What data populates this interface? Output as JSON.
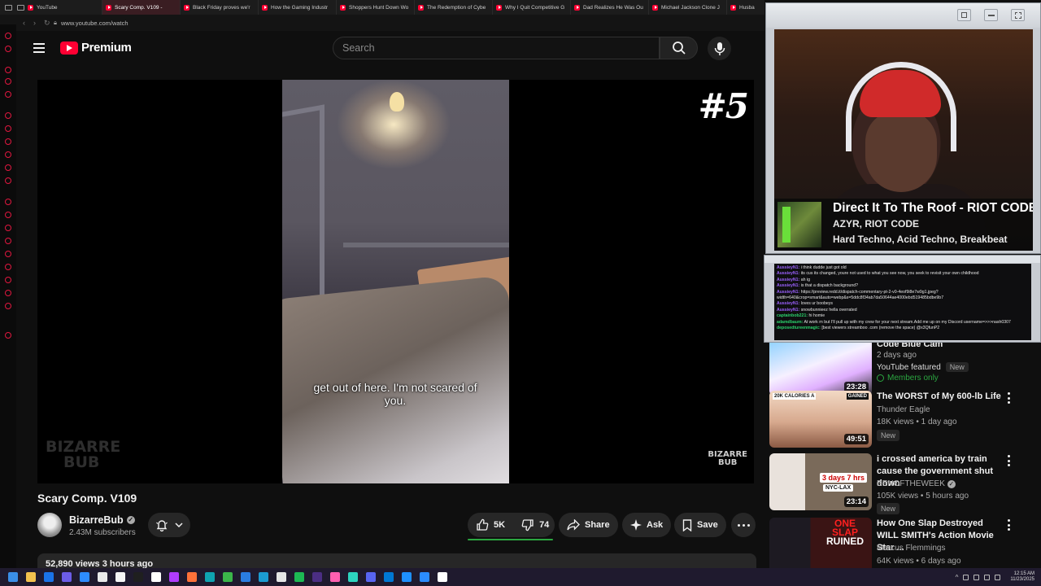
{
  "browser": {
    "tabs": [
      {
        "label": "YouTube",
        "active": false
      },
      {
        "label": "Scary Comp. V109 -",
        "active": true
      },
      {
        "label": "Black Friday proves we'r",
        "active": false
      },
      {
        "label": "How the Gaming Industr",
        "active": false
      },
      {
        "label": "Shoppers Hunt Down Wo",
        "active": false
      },
      {
        "label": "The Redemption of Cybe",
        "active": false
      },
      {
        "label": "Why I Quit Competitive G",
        "active": false
      },
      {
        "label": "Dad Realizes He Was Ou",
        "active": false
      },
      {
        "label": "Michael Jackson Clone J",
        "active": false
      },
      {
        "label": "Husba",
        "active": false
      }
    ],
    "url": "www.youtube.com/watch"
  },
  "header": {
    "logo_text": "Premium",
    "search_placeholder": "Search"
  },
  "video": {
    "subtitle": "get out of here. I'm not scared of you.",
    "episode_mark": "#5",
    "watermark_left_line1": "BIZARRE",
    "watermark_left_line2": "BUB",
    "watermark_right_line1": "BIZARRE",
    "watermark_right_line2": "BUB",
    "title": "Scary Comp. V109"
  },
  "channel": {
    "name": "BizarreBub",
    "subscribers": "2.43M subscribers"
  },
  "actions": {
    "likes": "5K",
    "dislikes": "74",
    "like_ratio": 0.985,
    "share": "Share",
    "ask": "Ask",
    "save": "Save"
  },
  "description": {
    "meta": "52,890 views  3 hours ago"
  },
  "recommendations": [
    {
      "title": "Code Blue Cam",
      "channel": "",
      "meta": "2 days ago",
      "featured": "YouTube featured",
      "badge": "New",
      "members": "Members only",
      "duration": "23:28"
    },
    {
      "title": "The WORST of My 600-lb Life",
      "channel": "Thunder Eagle",
      "meta": "18K views • 1 day ago",
      "badge": "New",
      "duration": "49:51",
      "thumb_text_left": "20K CALORIES A",
      "thumb_text_right": "GAINED"
    },
    {
      "title": "i crossed america by train cause the government shut down",
      "channel": "BENOFTHEWEEK",
      "meta": "105K views • 5 hours ago",
      "badge": "New",
      "duration": "23:14",
      "thumb_text_1": "3 days 7 hrs",
      "thumb_text_2": "NYC-LAX"
    },
    {
      "title": "How One Slap Destroyed WILL SMITH's Action Movie Star ...",
      "channel": "Marcus Flemmings",
      "meta": "64K views • 6 days ago",
      "thumb_text_1": "ONE",
      "thumb_text_2": "SLAP",
      "thumb_text_3": "RUINED"
    }
  ],
  "stream_overlay": {
    "now_playing_title": "Direct It To The Roof - RIOT CODE Remi",
    "now_playing_artist": "AZYR, RIOT CODE",
    "now_playing_genre": "Hard Techno, Acid Techno, Breakbeat"
  },
  "chat": [
    {
      "user": "AussieyN1:",
      "msg": "i think dudde just got old",
      "green": false
    },
    {
      "user": "AussieyN1:",
      "msg": "its cus its changed, youre not used to what you see now, you seek to revisit your own childhood",
      "green": false
    },
    {
      "user": "AussieyN1:",
      "msg": "ah ig",
      "green": false
    },
    {
      "user": "AussieyN1:",
      "msg": "is that a dispatch background?",
      "green": false
    },
    {
      "user": "AussieyN1:",
      "msg": "https://preview.redd.it/dispatch-commentary-pt-2-v0-4eof9i8e7w9g1.jpeg?",
      "green": false
    },
    {
      "user": "",
      "msg": "width=640&crop=smart&auto=webp&s=5ddc8f34ab7da50644ae4000ebd519485bdbe9b7",
      "green": false
    },
    {
      "user": "AussieyN1:",
      "msg": "loves ur boobeys",
      "green": false
    },
    {
      "user": "AussieyN1:",
      "msg": "snowbunnieez hella overrated",
      "green": false
    },
    {
      "user": "captainbob221:",
      "msg": "hi homie",
      "green": true
    },
    {
      "user": "adamdbaum:",
      "msg": "At work rn but I'll pull up with my crew for your next stream.Add me up on my Discord username=>>>nash0307",
      "green": true
    },
    {
      "user": "deposedtureenmagic:",
      "msg": "[best viewers streamboo .com (remove the space) @x3QfunP2",
      "green": true
    }
  ],
  "taskbar": {
    "time": "12:15 AM",
    "date": "11/23/2025",
    "icon_colors": [
      "#3a8ee6",
      "#f2c14e",
      "#1a73e8",
      "#6b5ce7",
      "#2d8cff",
      "#e9e9e9",
      "#f5f5f5",
      "#1f1f1f",
      "#ffffff",
      "#b03cff",
      "#ff7139",
      "#0fa3b1",
      "#3bb54a",
      "#2a7de1",
      "#1b9bd1",
      "#e5e5e5",
      "#1db954",
      "#4b2e83",
      "#ff5fb0",
      "#2dd4bf",
      "#5865f2",
      "#0078d4",
      "#1e90ff",
      "#2b8cff",
      "#ffffff"
    ]
  }
}
